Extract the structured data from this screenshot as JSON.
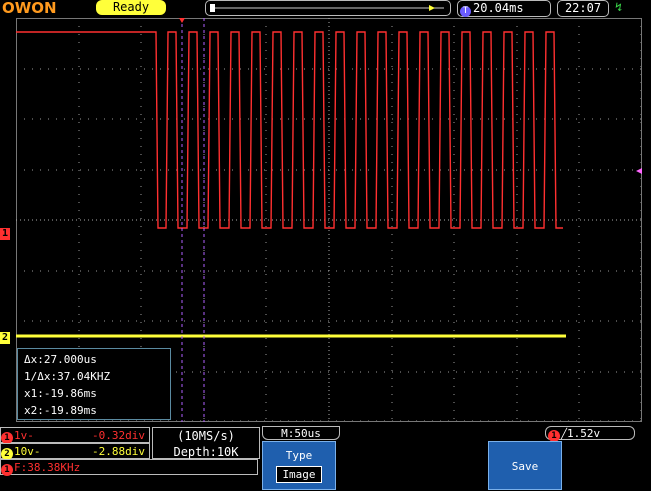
{
  "header": {
    "logo": "OWON",
    "status": "Ready",
    "time_position": "20.04ms",
    "time_icon": "T",
    "clock": "22:07",
    "usb_icon": "usb-icon"
  },
  "channels": {
    "ch1_marker": "1",
    "ch2_marker": "2",
    "ch1": {
      "id": "1",
      "scale": "1v-",
      "offset": "-0.32div",
      "color": "#ff3030"
    },
    "ch2": {
      "id": "2",
      "scale": "10v-",
      "offset": "-2.88div",
      "color": "#ffff3a"
    },
    "frequency": {
      "id": "1",
      "label": "F:38.38KHz"
    }
  },
  "cursor_measure": {
    "delta": "Δx:27.000us",
    "inverse": "1/Δx:37.04KHZ",
    "x1": "x1:-19.86ms",
    "x2": "x2:-19.89ms"
  },
  "acquisition": {
    "sample_rate": "(10MS/s)",
    "depth": "Depth:10K"
  },
  "timebase": "M:50us",
  "trigger": {
    "channel": "1",
    "level": "1.52v"
  },
  "menu": {
    "type_label": "Type",
    "type_value": "Image",
    "save_label": "Save"
  },
  "colors": {
    "ch1": "#ff3030",
    "ch2": "#ffff3a",
    "softkey": "#1f5fae",
    "cursor": "#b060ff"
  }
}
